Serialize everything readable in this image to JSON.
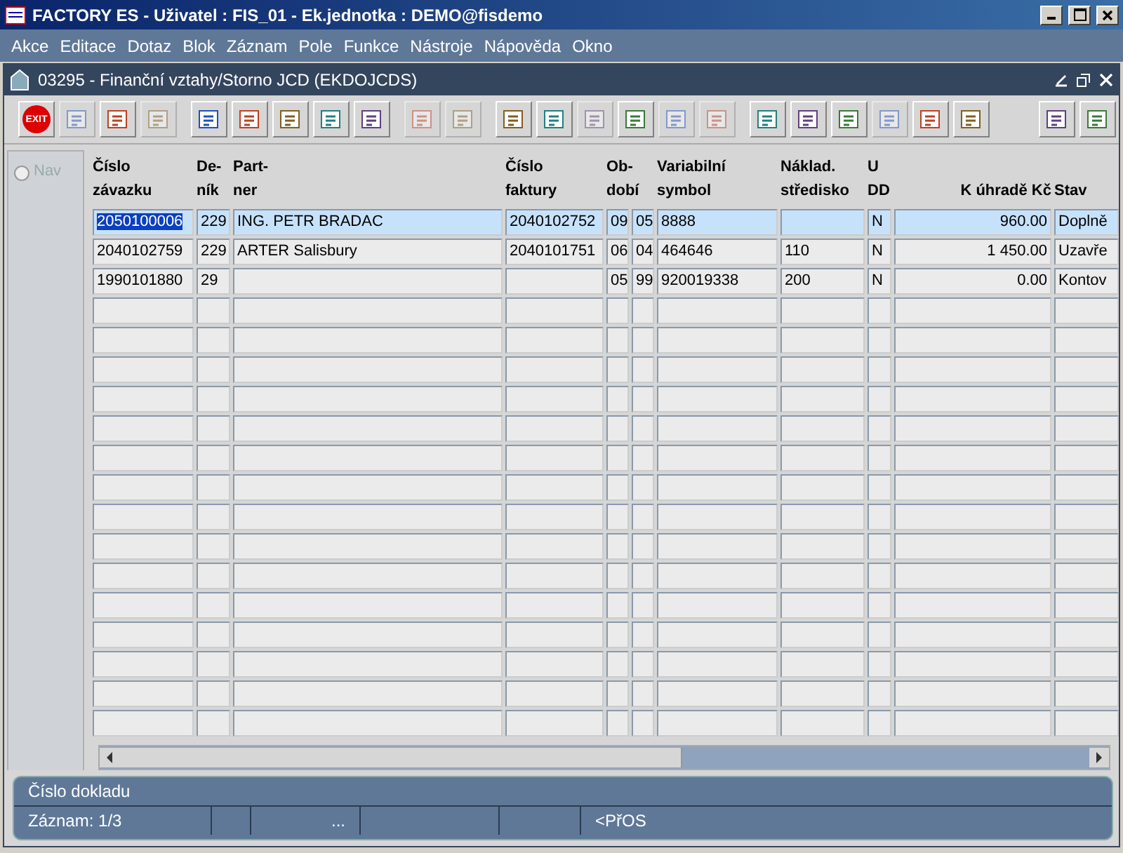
{
  "window": {
    "title": "FACTORY ES - Uživatel : FIS_01 - Ek.jednotka : DEMO@fisdemo"
  },
  "menu": [
    "Akce",
    "Editace",
    "Dotaz",
    "Blok",
    "Záznam",
    "Pole",
    "Funkce",
    "Nástroje",
    "Nápověda",
    "Okno"
  ],
  "form": {
    "title": "03295 - Finanční vztahy/Storno JCD (EKDOJCDS)"
  },
  "toolbar": [
    [
      {
        "label": "EXIT",
        "disabled": false
      },
      {
        "disabled": true
      },
      {
        "disabled": false
      },
      {
        "disabled": true
      }
    ],
    [
      {
        "disabled": false
      },
      {
        "disabled": false
      },
      {
        "disabled": false
      },
      {
        "disabled": false
      },
      {
        "disabled": false
      }
    ],
    [
      {
        "disabled": true
      },
      {
        "disabled": true
      }
    ],
    [
      {
        "disabled": false
      },
      {
        "disabled": false
      },
      {
        "disabled": true
      },
      {
        "disabled": false
      },
      {
        "disabled": true
      },
      {
        "disabled": true
      }
    ],
    [
      {
        "disabled": false
      },
      {
        "disabled": false
      },
      {
        "disabled": false
      },
      {
        "disabled": true
      },
      {
        "disabled": false
      },
      {
        "disabled": false
      }
    ],
    [
      {
        "disabled": false
      },
      {
        "disabled": false
      }
    ]
  ],
  "nav": {
    "label": "Nav",
    "selected": false,
    "disabled": true
  },
  "table": {
    "columns": [
      {
        "lines": [
          "Číslo",
          "závazku"
        ]
      },
      {
        "lines": [
          "De-",
          "ník"
        ]
      },
      {
        "lines": [
          "Part-",
          "ner"
        ]
      },
      {
        "lines": [
          "Číslo",
          "faktury"
        ]
      },
      {
        "lines": [
          "Ob-",
          "dobí"
        ]
      },
      {
        "lines": [
          "Variabilní",
          "symbol"
        ]
      },
      {
        "lines": [
          "Náklad.",
          "středisko"
        ]
      },
      {
        "lines": [
          "U",
          "DD"
        ]
      },
      {
        "lines": [
          "K úhradě Kč"
        ]
      },
      {
        "lines": [
          "Stav"
        ]
      }
    ],
    "rows": [
      {
        "selected": true,
        "cells": [
          "2050100006",
          "229",
          "ING. PETR BRADAC",
          "2040102752",
          [
            "09",
            "05"
          ],
          "8888",
          "",
          "N",
          "960.00",
          "Doplně"
        ]
      },
      {
        "selected": false,
        "cells": [
          "2040102759",
          "229",
          "ARTER Salisbury",
          "2040101751",
          [
            "06",
            "04"
          ],
          "464646",
          "110",
          "N",
          "1 450.00",
          "Uzavře"
        ]
      },
      {
        "selected": false,
        "cells": [
          "1990101880",
          "29",
          "",
          "",
          [
            "05",
            "99"
          ],
          "920019338",
          "200",
          "N",
          "0.00",
          "Kontov"
        ]
      }
    ]
  },
  "status_bar": {
    "hint": "Číslo dokladu",
    "record": "Záznam: 1/3",
    "ellipsis": "...",
    "mode": "<PřOS"
  }
}
